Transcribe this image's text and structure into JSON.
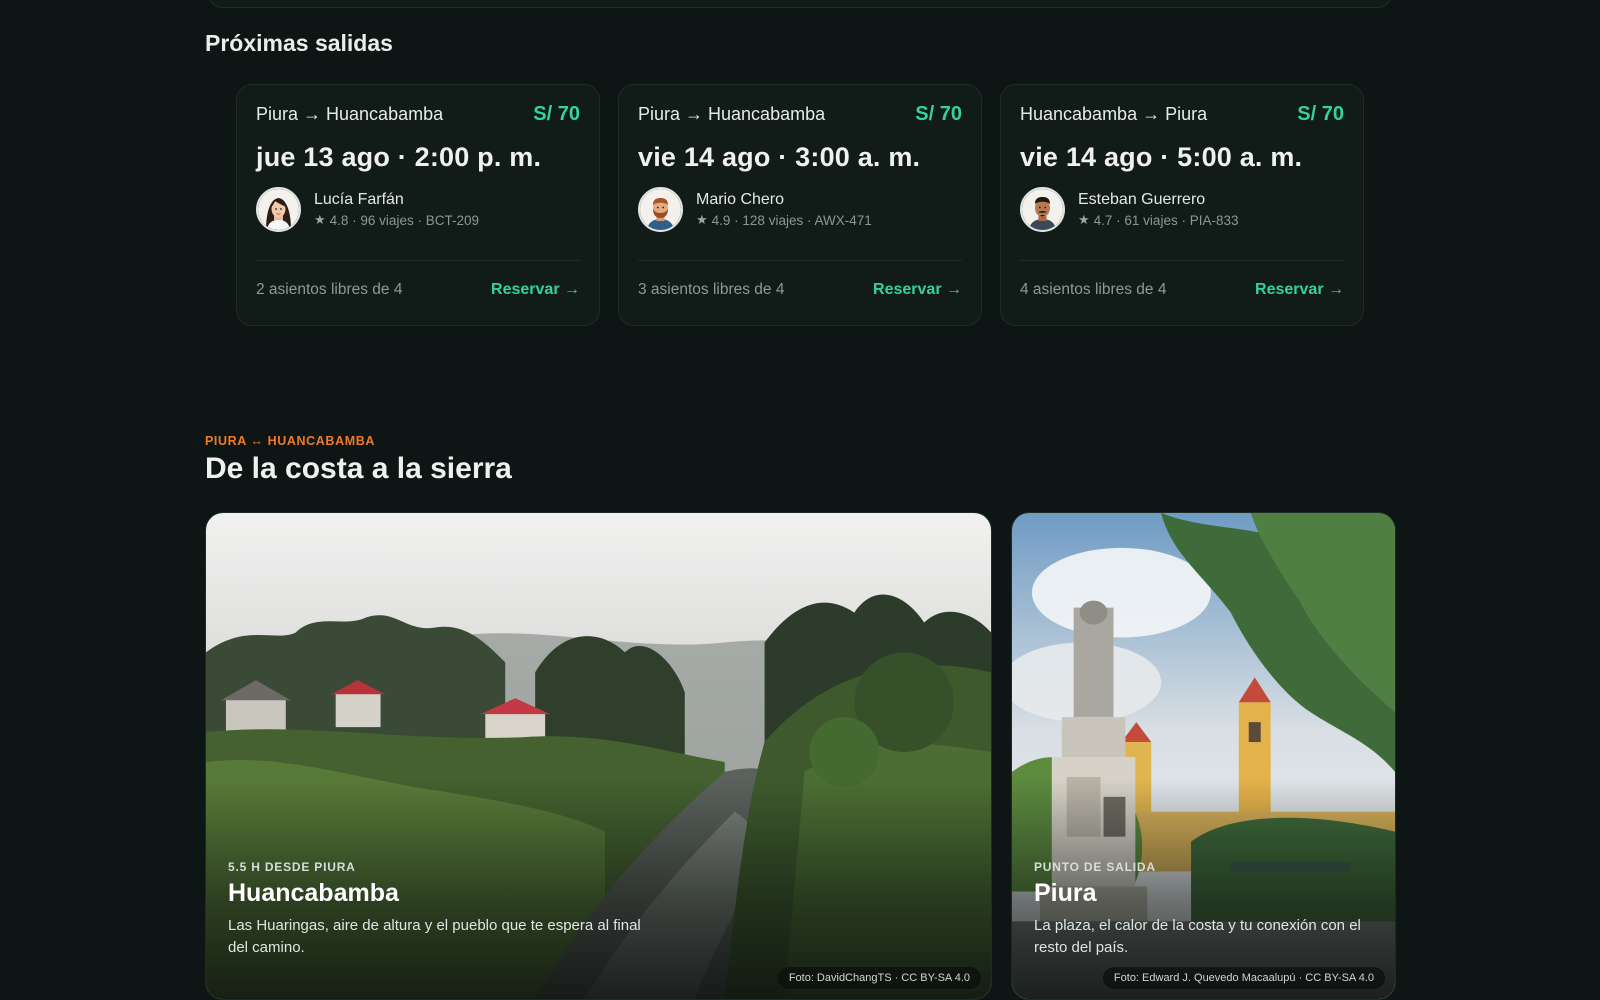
{
  "upcoming": {
    "title": "Próximas salidas",
    "trips": [
      {
        "route": "Piura → Huancabamba",
        "price": "S/ 70",
        "date": "jue 13 ago · 2:00 p. m.",
        "driver": "Lucía Farfán",
        "meta": "4.8 · 96 viajes · BCT-209",
        "seats": "2 asientos libres de 4",
        "reserve": "Reservar →",
        "avatar_icon": "woman-avatar-icon"
      },
      {
        "route": "Piura → Huancabamba",
        "price": "S/ 70",
        "date": "vie 14 ago · 3:00 a. m.",
        "driver": "Mario Chero",
        "meta": "4.9 · 128 viajes · AWX-471",
        "seats": "3 asientos libres de 4",
        "reserve": "Reservar →",
        "avatar_icon": "bearded-man-avatar-icon"
      },
      {
        "route": "Huancabamba → Piura",
        "price": "S/ 70",
        "date": "vie 14 ago · 5:00 a. m.",
        "driver": "Esteban Guerrero",
        "meta": "4.7 · 61 viajes · PIA-833",
        "seats": "4 asientos libres de 4",
        "reserve": "Reservar →",
        "avatar_icon": "mustache-man-avatar-icon"
      }
    ]
  },
  "route_section": {
    "eyebrow": "PIURA ↔ HUANCABAMBA",
    "title": "De la costa a la sierra",
    "destinations": [
      {
        "kicker": "5.5 H DESDE PIURA",
        "name": "Huancabamba",
        "description": "Las Huaringas, aire de altura y el pueblo que te espera al final del camino.",
        "credit": "Foto: DavidChangTS · CC BY-SA 4.0"
      },
      {
        "kicker": "PUNTO DE SALIDA",
        "name": "Piura",
        "description": "La plaza, el calor de la costa y tu conexión con el resto del país.",
        "credit": "Foto: Edward J. Quevedo Macaalupú · CC BY-SA 4.0"
      }
    ]
  },
  "colors": {
    "background": "#0d1614",
    "card": "#111b18",
    "accent_green": "#34d399",
    "accent_orange": "#f07a2a"
  }
}
